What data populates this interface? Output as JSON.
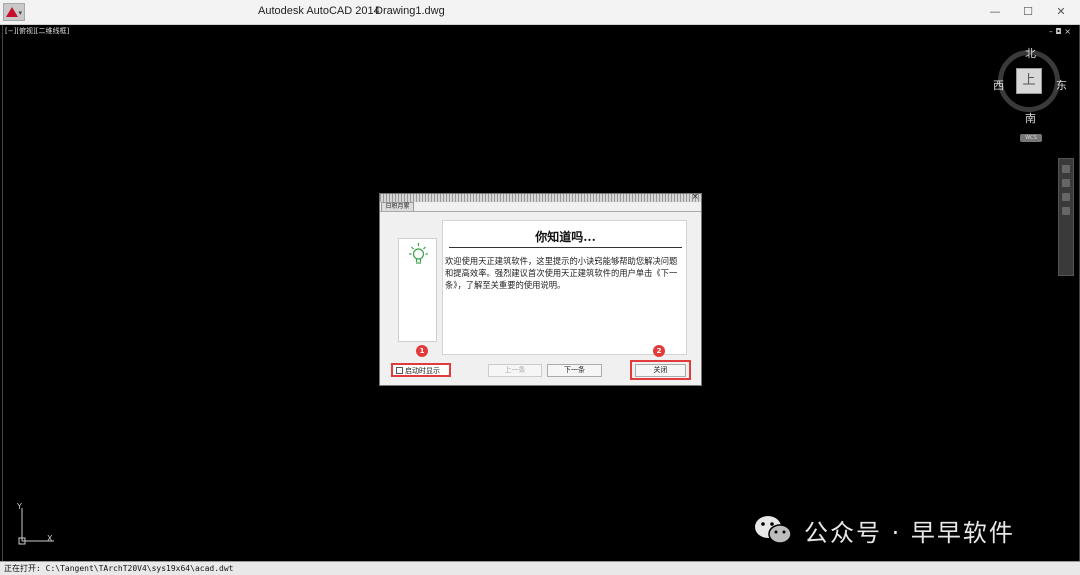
{
  "titlebar": {
    "app_name": "Autodesk AutoCAD 2014",
    "document": "Drawing1.dwg",
    "logo_arrow": "▾",
    "minimize": "—",
    "maximize": "☐",
    "close": "✕"
  },
  "viewport": {
    "label": "[−][俯视][二维线框]",
    "controls": "– ◘ ×"
  },
  "viewcube": {
    "north": "北",
    "south": "南",
    "east": "东",
    "west": "西",
    "top": "上",
    "wcs": "WCS"
  },
  "ucs": {
    "x_label": "X",
    "y_label": "Y"
  },
  "dialog": {
    "tab_label": "日积月累",
    "close_glyph": "×",
    "heading": "你知道吗...",
    "body": "欢迎使用天正建筑软件，这里提示的小诀窍能够帮助您解决问题和提高效率。强烈建议首次使用天正建筑软件的用户单击《下一条》，了解至关重要的使用说明。",
    "checkbox_label": "启动时显示",
    "checkbox_checked": false,
    "prev_label": "上一条",
    "next_label": "下一条",
    "close_label": "关闭",
    "badge_1": "1",
    "badge_2": "2",
    "icon": "lightbulb-icon"
  },
  "statusbar": {
    "text": "正在打开: C:\\Tangent\\TArchT20V4\\sys19x64\\acad.dwt"
  },
  "watermark": {
    "text": "公众号 · 早早软件"
  },
  "colors": {
    "highlight": "#e23b3b",
    "canvas": "#000000",
    "bulb": "#3aa34a"
  }
}
